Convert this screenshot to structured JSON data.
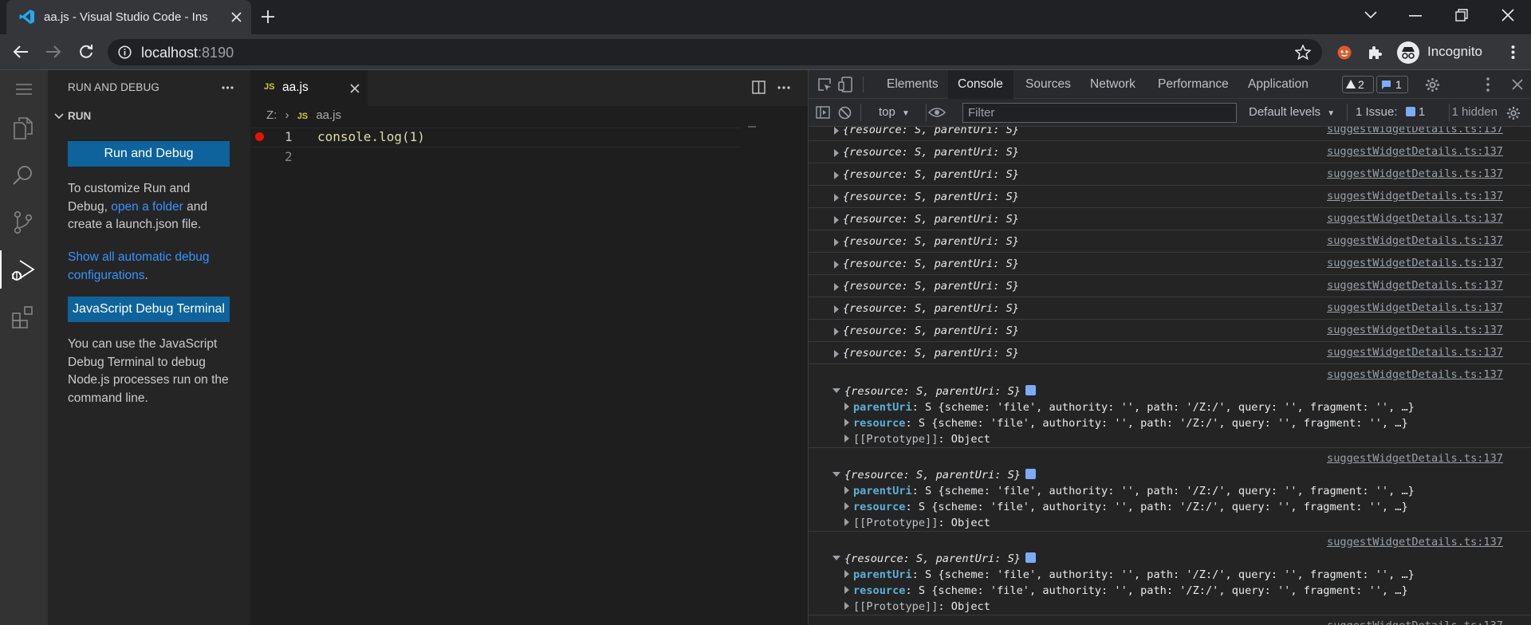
{
  "browser": {
    "tab_title": "aa.js - Visual Studio Code - Ins",
    "url_host": "localhost",
    "url_port": ":8190",
    "profile_label": "Incognito"
  },
  "vscode": {
    "sidebar": {
      "title": "RUN AND DEBUG",
      "section": "RUN",
      "run_button": "Run and Debug",
      "customize_pre": "To customize Run and Debug,",
      "open_folder_link": "open a folder",
      "customize_post": "and create a launch.json file.",
      "show_configs_link": "Show all automatic debug configurations",
      "terminal_button": "JavaScript Debug Terminal",
      "terminal_text": "You can use the JavaScript Debug Terminal to debug Node.js processes run on the command line."
    },
    "editor": {
      "tab_icon": "JS",
      "tab_label": "aa.js",
      "breadcrumb_root": "Z:",
      "breadcrumb_file": "aa.js",
      "lines": [
        {
          "num": "1",
          "code": "console.log(1)"
        },
        {
          "num": "2",
          "code": ""
        }
      ]
    }
  },
  "devtools": {
    "tabs": [
      "Elements",
      "Console",
      "Sources",
      "Network",
      "Performance",
      "Application"
    ],
    "active_tab": "Console",
    "warnings_count": "2",
    "messages_count": "1",
    "context": "top",
    "filter_placeholder": "Filter",
    "levels": "Default levels",
    "issues_label": "1 Issue:",
    "issues_count": "1",
    "hidden_label": "1 hidden",
    "source": "suggestWidgetDetails.ts:137",
    "collapsed_summary": "{resource: S, parentUri: S}",
    "collapsed_rows": 11,
    "expanded": {
      "summary": "{resource: S, parentUri: S}",
      "parent_key": "parentUri",
      "resource_key": "resource",
      "prop_value": "S {scheme: 'file', authority: '', path: '/Z:/', query: '', fragment: '', …}",
      "prototype_key": "[[Prototype]]",
      "prototype_value": "Object"
    },
    "expanded_rows": 3
  }
}
